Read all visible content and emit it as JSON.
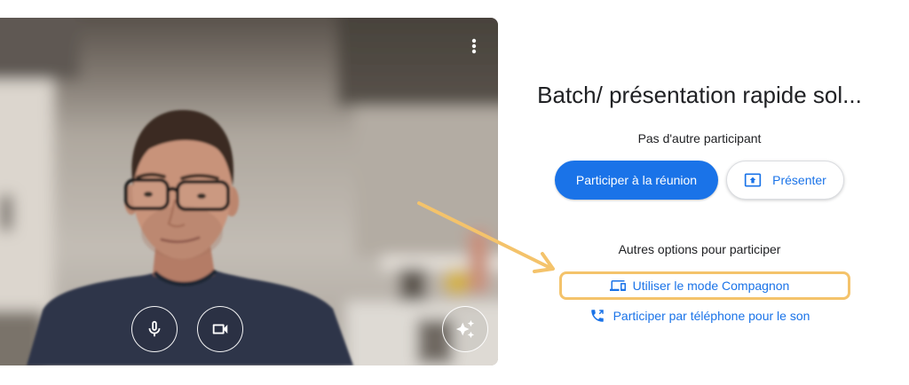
{
  "preview": {
    "more_options_icon": "more-vert-icon",
    "mic_icon": "mic-icon",
    "camera_icon": "videocam-icon",
    "effects_icon": "sparkles-icon"
  },
  "meeting": {
    "title": "Batch/ présentation rapide sol...",
    "status": "Pas d'autre participant"
  },
  "actions": {
    "join_label": "Participer à la réunion",
    "present_label": "Présenter",
    "present_icon": "present-to-all-icon"
  },
  "other_options": {
    "heading": "Autres options pour participer",
    "companion_mode": {
      "label": "Utiliser le mode Compagnon",
      "icon": "devices-icon",
      "highlighted": true
    },
    "phone_audio": {
      "label": "Participer par téléphone pour le son",
      "icon": "phone-forwarded-icon"
    }
  },
  "colors": {
    "accent": "#1a73e8",
    "text": "#202124",
    "button_border": "#dadce0",
    "annotation": "#f4c36b",
    "page_background": "#ffffff"
  }
}
